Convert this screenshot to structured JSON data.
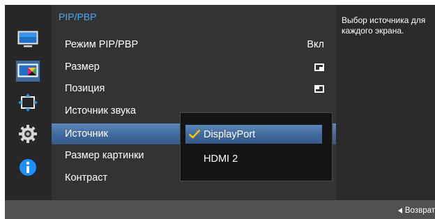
{
  "header": {
    "title": "PIP/PBP"
  },
  "sidebar": {
    "icons": [
      {
        "name": "picture-monitor-icon"
      },
      {
        "name": "pip-pbp-icon"
      },
      {
        "name": "position-arrows-icon"
      },
      {
        "name": "settings-gear-icon"
      },
      {
        "name": "info-icon"
      }
    ],
    "active_index": 1
  },
  "menu": {
    "items": [
      {
        "label": "Режим PIP/PBP",
        "value": "Вкл"
      },
      {
        "label": "Размер",
        "value_icon": "size-small-window-icon"
      },
      {
        "label": "Позиция",
        "value_icon": "position-top-left-icon"
      },
      {
        "label": "Источник звука"
      },
      {
        "label": "Источник"
      },
      {
        "label": "Размер картинки"
      },
      {
        "label": "Контраст"
      }
    ],
    "selected_index": 4
  },
  "dropdown": {
    "options": [
      {
        "label": "DisplayPort"
      },
      {
        "label": "HDMI 2"
      }
    ],
    "selected_index": 0
  },
  "help": {
    "text": "Выбор источника для каждого экрана."
  },
  "footer": {
    "return_label": "Возврат"
  },
  "colors": {
    "accent": "#4aa9ff",
    "selection": "#40689a",
    "check": "#f5c400",
    "info": "#1f8fff"
  }
}
